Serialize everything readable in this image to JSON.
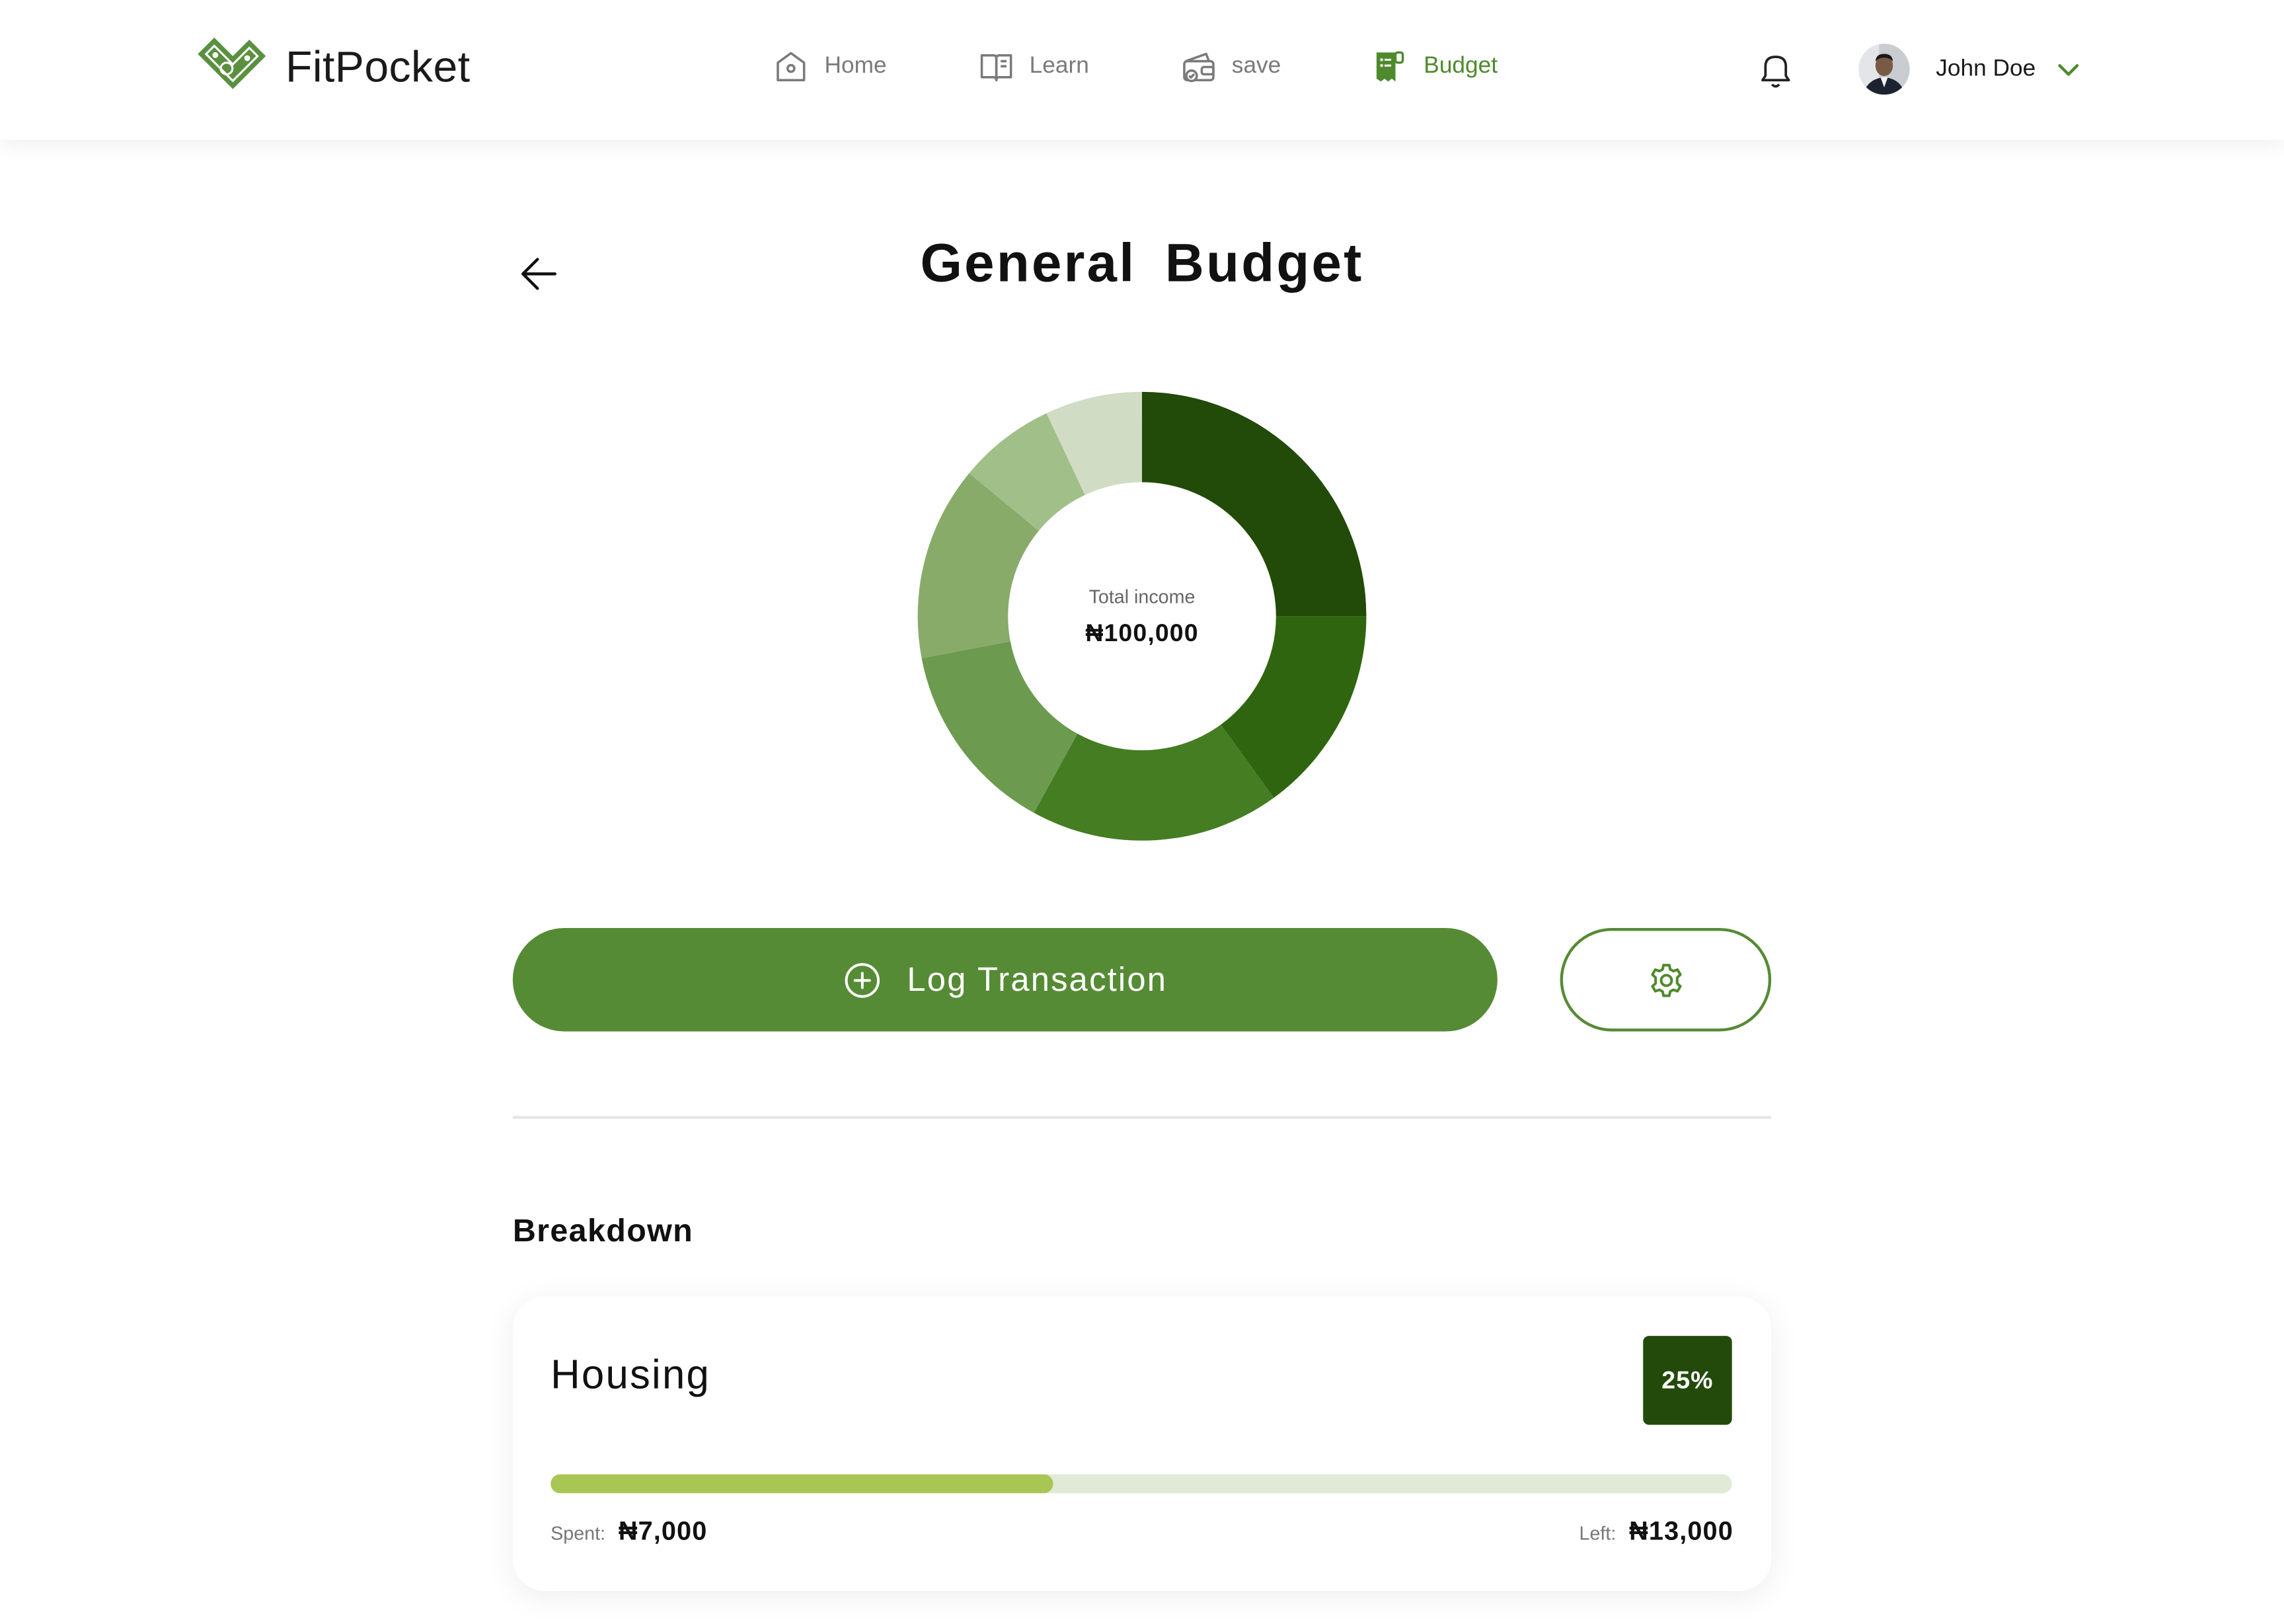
{
  "app": {
    "brand": "FitPocket"
  },
  "nav": {
    "items": [
      {
        "label": "Home",
        "icon": "home-icon"
      },
      {
        "label": "Learn",
        "icon": "book-icon"
      },
      {
        "label": "save",
        "icon": "wallet-icon"
      },
      {
        "label": "Budget",
        "icon": "receipt-icon",
        "active": true
      }
    ]
  },
  "user": {
    "name": "John Doe"
  },
  "page": {
    "title": "General Budget"
  },
  "summary": {
    "label": "Total income",
    "value": "₦100,000"
  },
  "chart_data": {
    "type": "pie",
    "style": "donut",
    "slices": [
      {
        "value": 25,
        "color": "#224a08"
      },
      {
        "value": 15,
        "color": "#2f650f"
      },
      {
        "value": 18,
        "color": "#447d22"
      },
      {
        "value": 14,
        "color": "#6c9a4f"
      },
      {
        "value": 14,
        "color": "#88ab6a"
      },
      {
        "value": 7,
        "color": "#a1bf88"
      },
      {
        "value": 7,
        "color": "#d0dcc4"
      }
    ]
  },
  "actions": {
    "log_label": "Log Transaction"
  },
  "breakdown": {
    "title": "Breakdown",
    "items": [
      {
        "name": "Housing",
        "percent": "25%",
        "spent_label": "Spent:",
        "spent": "₦7,000",
        "left_label": "Left:",
        "left": "₦13,000",
        "progress": 0.425
      }
    ]
  },
  "colors": {
    "primary": "#558b35",
    "dark": "#234a0a",
    "progress": "#a8c653",
    "progress_track": "#e0ead6"
  }
}
